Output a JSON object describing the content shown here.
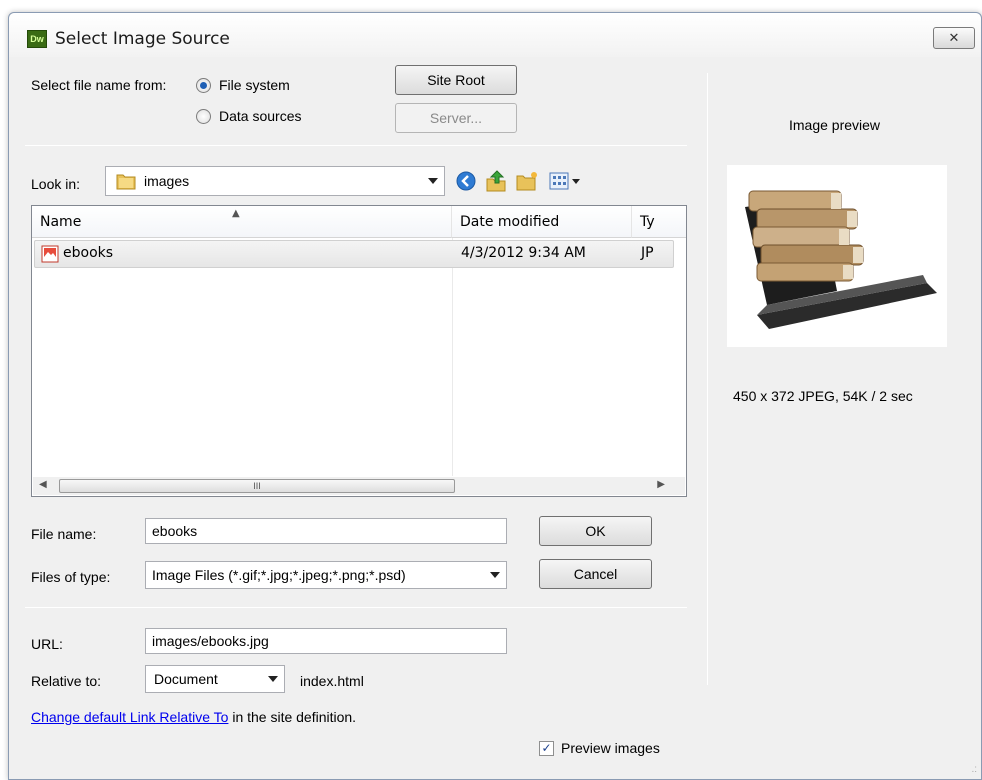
{
  "window": {
    "app_icon_text": "Dw",
    "title": "Select Image Source",
    "close_glyph": "✕"
  },
  "source": {
    "label": "Select file name from:",
    "options": [
      {
        "label": "File system",
        "checked": true
      },
      {
        "label": "Data sources",
        "checked": false
      }
    ],
    "site_root_label": "Site Root",
    "server_label": "Server..."
  },
  "look_in": {
    "label": "Look in:",
    "folder": "images",
    "icons": [
      "back-icon",
      "up-folder-icon",
      "new-folder-icon",
      "view-menu-icon"
    ]
  },
  "file_list": {
    "columns": [
      "Name",
      "Date modified",
      "Ty"
    ],
    "rows": [
      {
        "name": "ebooks",
        "date": "4/3/2012 9:34 AM",
        "type": "JP"
      }
    ],
    "scroll_thumb_glyph": "III"
  },
  "file_name": {
    "label": "File name:",
    "value": "ebooks"
  },
  "file_type": {
    "label": "Files of type:",
    "value": "Image Files (*.gif;*.jpg;*.jpeg;*.png;*.psd)"
  },
  "buttons": {
    "ok": "OK",
    "cancel": "Cancel"
  },
  "url": {
    "label": "URL:",
    "value": "images/ebooks.jpg"
  },
  "relative": {
    "label": "Relative to:",
    "value": "Document",
    "file": "index.html"
  },
  "footer": {
    "link_text": "Change default Link Relative To",
    "rest_text": " in the site definition.",
    "preview_label": "Preview images",
    "preview_checked": true
  },
  "preview": {
    "heading": "Image preview",
    "info": "450 x 372 JPEG, 54K / 2 sec"
  },
  "colors": {
    "accent": "#1e5fb5",
    "link": "#0000ee",
    "app_icon": "#3a6b14"
  }
}
